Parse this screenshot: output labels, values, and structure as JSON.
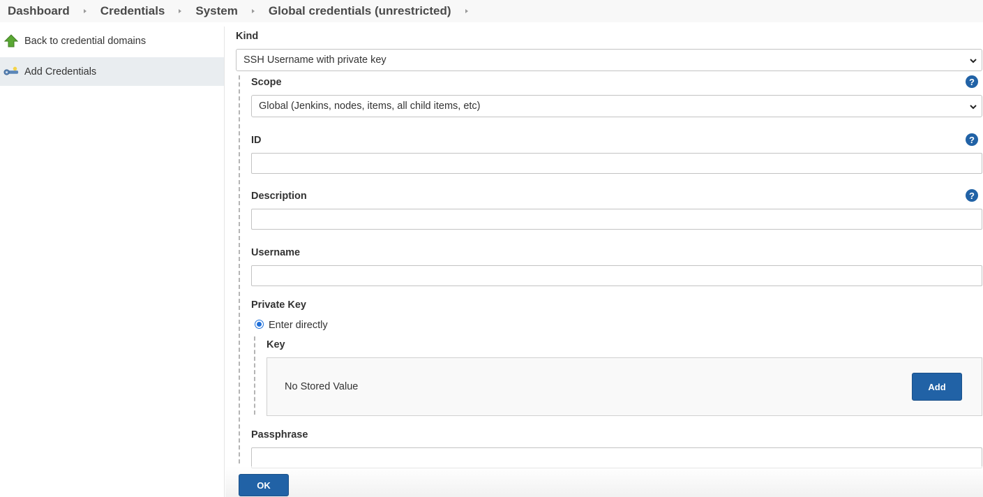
{
  "breadcrumbs": [
    {
      "label": "Dashboard"
    },
    {
      "label": "Credentials"
    },
    {
      "label": "System"
    },
    {
      "label": "Global credentials (unrestricted)"
    }
  ],
  "sidebar": {
    "items": [
      {
        "label": "Back to credential domains",
        "icon": "up-arrow-icon"
      },
      {
        "label": "Add Credentials",
        "icon": "key-icon"
      }
    ]
  },
  "form": {
    "kind": {
      "label": "Kind",
      "value": "SSH Username with private key"
    },
    "scope": {
      "label": "Scope",
      "value": "Global (Jenkins, nodes, items, all child items, etc)"
    },
    "id": {
      "label": "ID",
      "value": ""
    },
    "description": {
      "label": "Description",
      "value": ""
    },
    "username": {
      "label": "Username",
      "value": ""
    },
    "private_key": {
      "label": "Private Key",
      "option": "Enter directly",
      "key_label": "Key",
      "key_status": "No Stored Value",
      "add_label": "Add"
    },
    "passphrase": {
      "label": "Passphrase",
      "value": ""
    },
    "ok_label": "OK",
    "help_glyph": "?"
  },
  "colors": {
    "accent": "#2162a6",
    "radio": "#1e6fd9",
    "arrow_green": "#5aa834"
  }
}
